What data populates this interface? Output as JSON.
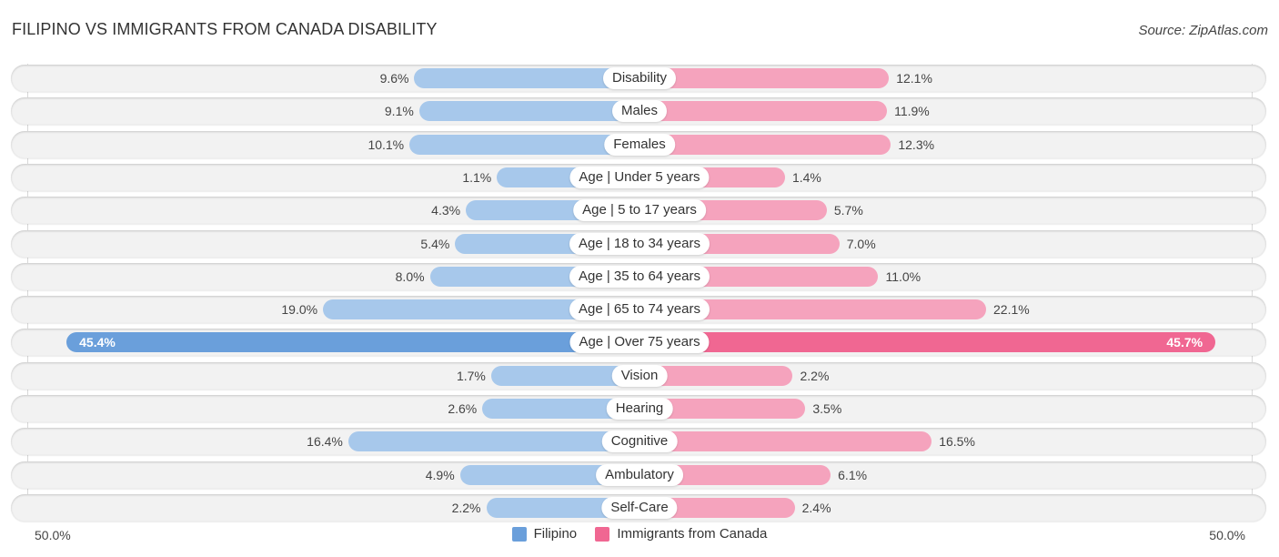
{
  "header": {
    "title": "FILIPINO VS IMMIGRANTS FROM CANADA DISABILITY",
    "source": "Source: ZipAtlas.com"
  },
  "colors": {
    "filipino": "#6a9fdb",
    "filipino_light": "#a7c8eb",
    "canada": "#f06792",
    "canada_light": "#f5a3bd"
  },
  "chart_data": {
    "type": "bar",
    "orientation": "horizontal-diverging",
    "title": "FILIPINO VS IMMIGRANTS FROM CANADA DISABILITY",
    "categories": [
      "Disability",
      "Males",
      "Females",
      "Age | Under 5 years",
      "Age | 5 to 17 years",
      "Age | 18 to 34 years",
      "Age | 35 to 64 years",
      "Age | 65 to 74 years",
      "Age | Over 75 years",
      "Vision",
      "Hearing",
      "Cognitive",
      "Ambulatory",
      "Self-Care"
    ],
    "series": [
      {
        "name": "Filipino",
        "values": [
          9.6,
          9.1,
          10.1,
          1.1,
          4.3,
          5.4,
          8.0,
          19.0,
          45.4,
          1.7,
          2.6,
          16.4,
          4.9,
          2.2
        ],
        "labels": [
          "9.6%",
          "9.1%",
          "10.1%",
          "1.1%",
          "4.3%",
          "5.4%",
          "8.0%",
          "19.0%",
          "45.4%",
          "1.7%",
          "2.6%",
          "16.4%",
          "4.9%",
          "2.2%"
        ]
      },
      {
        "name": "Immigrants from Canada",
        "values": [
          12.1,
          11.9,
          12.3,
          1.4,
          5.7,
          7.0,
          11.0,
          22.1,
          45.7,
          2.2,
          3.5,
          16.5,
          6.1,
          2.4
        ],
        "labels": [
          "12.1%",
          "11.9%",
          "12.3%",
          "1.4%",
          "5.7%",
          "7.0%",
          "11.0%",
          "22.1%",
          "45.7%",
          "2.2%",
          "3.5%",
          "16.5%",
          "6.1%",
          "2.4%"
        ]
      }
    ],
    "xlim": [
      0,
      50
    ],
    "axis_left_label": "50.0%",
    "axis_right_label": "50.0%",
    "legend": [
      "Filipino",
      "Immigrants from Canada"
    ],
    "legend_position": "bottom-center",
    "unit": "%"
  }
}
